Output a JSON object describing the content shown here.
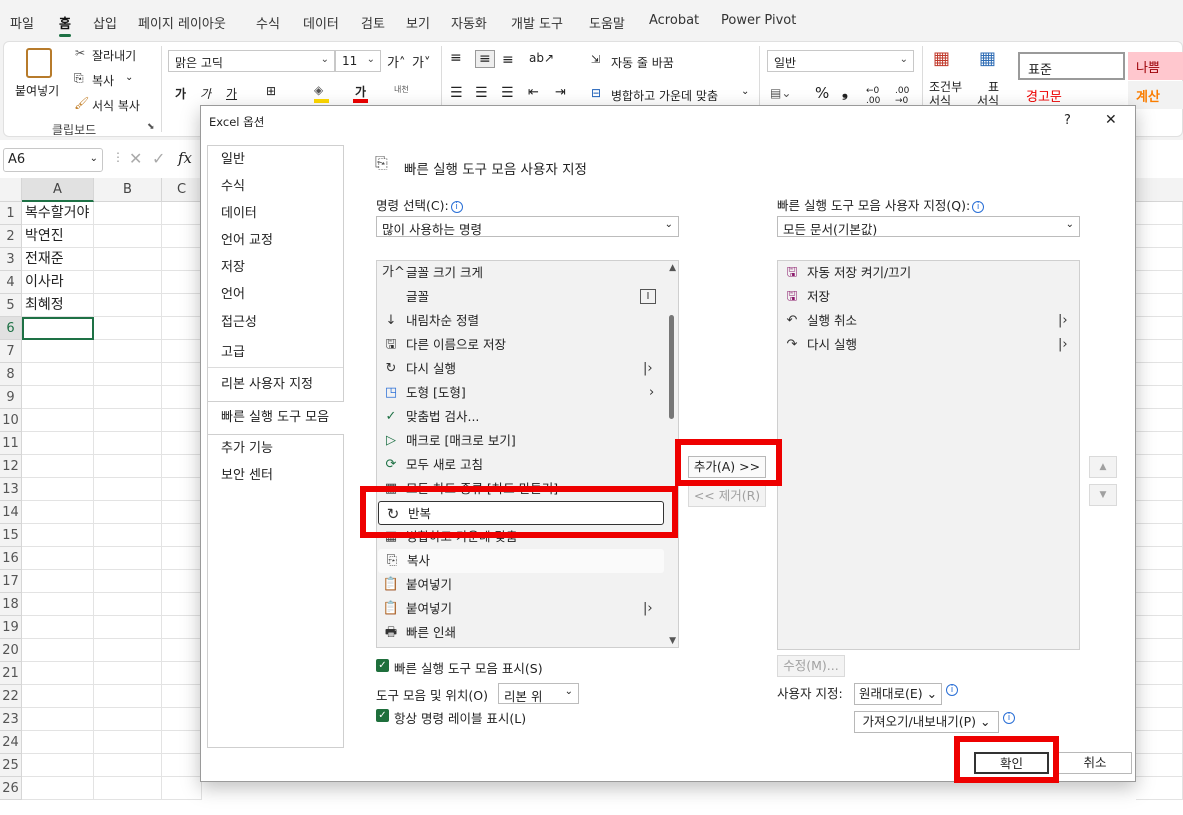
{
  "menu": [
    "파일",
    "홈",
    "삽입",
    "페이지 레이아웃",
    "수식",
    "데이터",
    "검토",
    "보기",
    "자동화",
    "개발 도구",
    "도움말",
    "Acrobat",
    "Power Pivot"
  ],
  "ribbon": {
    "paste": "붙여넣기",
    "cut": "잘라내기",
    "copy": "복사",
    "format_painter": "서식 복사",
    "clipboard": "클립보드",
    "font_name": "맑은 고딕",
    "font_size": "11",
    "wrap_text": "자동 줄 바꿈",
    "merge_center": "병합하고 가운데 맞춤",
    "number_format": "일반",
    "percent": "%",
    "conditional": "조건부",
    "conditional2": "서식",
    "table": "표",
    "table2": "서식",
    "style_normal": "표준",
    "style_bad": "나쁨",
    "style_warning": "경고문",
    "style_calc": "계산"
  },
  "formula_bar": {
    "name_box": "A6",
    "fx": "fx"
  },
  "sheet": {
    "columns": [
      "A",
      "B",
      "C"
    ],
    "rows": [
      "1",
      "2",
      "3",
      "4",
      "5",
      "6",
      "7",
      "8",
      "9",
      "10",
      "11",
      "12",
      "13",
      "14",
      "15",
      "16",
      "17",
      "18",
      "19",
      "20",
      "21",
      "22",
      "23",
      "24",
      "25",
      "26"
    ],
    "cells": [
      "복수할거야",
      "박연진",
      "전재준",
      "이사라",
      "최혜정"
    ]
  },
  "dialog": {
    "title": "Excel 옵션",
    "help": "?",
    "close": "✕",
    "nav": [
      "일반",
      "수식",
      "데이터",
      "언어 교정",
      "저장",
      "언어",
      "접근성",
      "고급",
      "리본 사용자 지정",
      "빠른 실행 도구 모음",
      "추가 기능",
      "보안 센터"
    ],
    "heading": "빠른 실행 도구 모음 사용자 지정",
    "choose_label": "명령 선택(C):",
    "choose_value": "많이 사용하는 명령",
    "customize_label": "빠른 실행 도구 모음 사용자 지정(Q):",
    "customize_value": "모든 문서(기본값)",
    "commands": [
      {
        "icon": "가^",
        "label": "글꼴 크기 크게"
      },
      {
        "icon": "",
        "label": "글꼴"
      },
      {
        "icon": "↓",
        "label": "내림차순 정렬"
      },
      {
        "icon": "🖫",
        "label": "다른 이름으로 저장"
      },
      {
        "icon": "↻",
        "label": "다시 실행"
      },
      {
        "icon": "◳",
        "label": "도형 [도형]"
      },
      {
        "icon": "✓",
        "label": "맞춤법 검사..."
      },
      {
        "icon": "▷",
        "label": "매크로 [매크로 보기]"
      },
      {
        "icon": "⟳",
        "label": "모두 새로 고침"
      },
      {
        "icon": "▦",
        "label": "모든 차트 종류 [차트 만들기]"
      },
      {
        "icon": "↻",
        "label": "반복"
      },
      {
        "icon": "▦",
        "label": "병합하고 가운데 맞춤"
      },
      {
        "icon": "⎘",
        "label": "복사"
      },
      {
        "icon": "📋",
        "label": "붙여넣기"
      },
      {
        "icon": "📋",
        "label": "붙여넣기"
      },
      {
        "icon": "🖶",
        "label": "빠른 인쇄"
      }
    ],
    "qat_items": [
      {
        "icon": "🖫",
        "label": "자동 저장 켜기/끄기"
      },
      {
        "icon": "🖫",
        "label": "저장"
      },
      {
        "icon": "↶",
        "label": "실행 취소"
      },
      {
        "icon": "↷",
        "label": "다시 실행"
      }
    ],
    "add_button": "추가(A) >>",
    "remove_button": "<< 제거(R)",
    "modify_button": "수정(M)...",
    "show_qat": "빠른 실행 도구 모음 표시(S)",
    "position_label": "도구 모음 및 위치(O)",
    "position_value": "리본 위",
    "always_labels": "항상 명령 레이블 표시(L)",
    "customizations_label": "사용자 지정:",
    "reset_button": "원래대로(E)",
    "import_export_button": "가져오기/내보내기(P)",
    "ok_button": "확인",
    "cancel_button": "취소"
  },
  "colors": {
    "highlight": "#ee0000",
    "excel_green": "#1e7145"
  }
}
